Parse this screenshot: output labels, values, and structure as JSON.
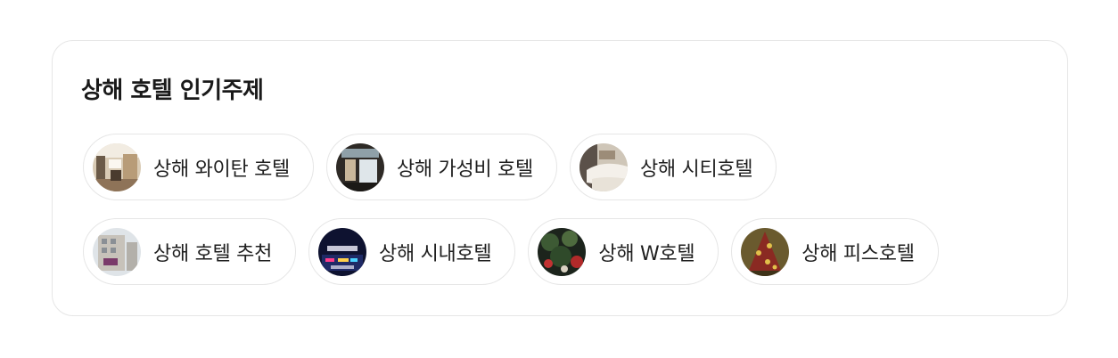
{
  "section": {
    "title": "상해 호텔 인기주제"
  },
  "chips": [
    {
      "label": "상해 와이탄 호텔",
      "thumb": "white-tan-hotel-thumbnail"
    },
    {
      "label": "상해 가성비 호텔",
      "thumb": "budget-hotel-thumbnail"
    },
    {
      "label": "상해 시티호텔",
      "thumb": "city-hotel-thumbnail"
    },
    {
      "label": "상해 호텔 추천",
      "thumb": "hotel-recommendation-thumbnail"
    },
    {
      "label": "상해 시내호텔",
      "thumb": "downtown-hotel-thumbnail"
    },
    {
      "label": "상해 W호텔",
      "thumb": "w-hotel-thumbnail"
    },
    {
      "label": "상해 피스호텔",
      "thumb": "peace-hotel-thumbnail"
    }
  ]
}
